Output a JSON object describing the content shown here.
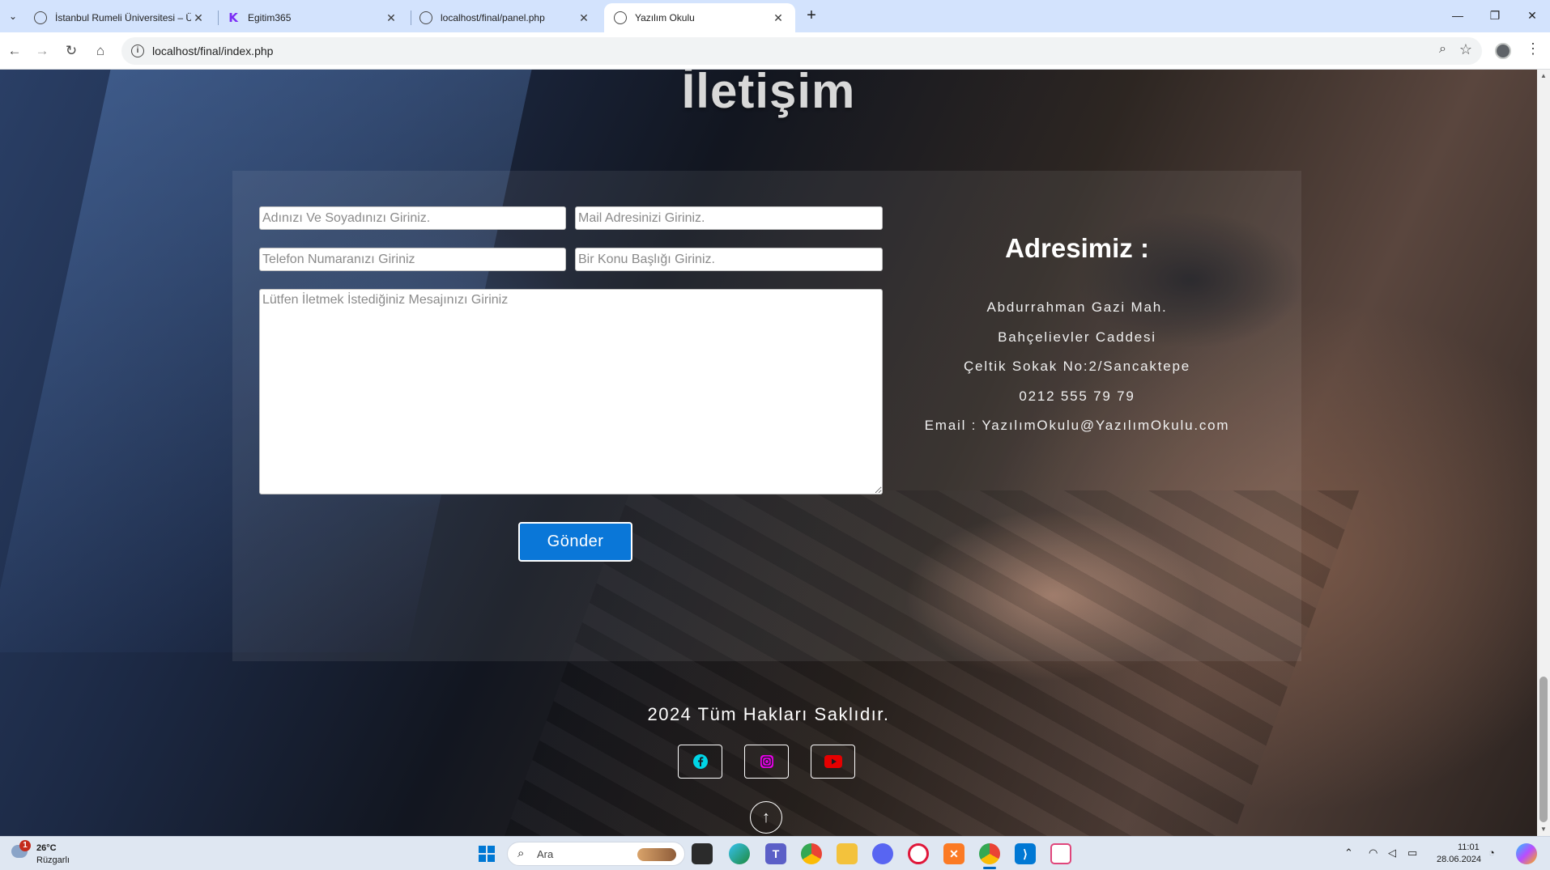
{
  "browser": {
    "tabs": [
      {
        "title": "İstanbul Rumeli Üniversitesi – Ü",
        "favicon": "globe-icon",
        "active": false
      },
      {
        "title": "Egitim365",
        "favicon": "k-logo-icon",
        "active": false
      },
      {
        "title": "localhost/final/panel.php",
        "favicon": "globe-icon",
        "active": false
      },
      {
        "title": "Yazılım Okulu",
        "favicon": "globe-icon",
        "active": true
      }
    ],
    "url": "localhost/final/index.php"
  },
  "page": {
    "title": "İletişim",
    "form": {
      "name_placeholder": "Adınızı Ve Soyadınızı Giriniz.",
      "email_placeholder": "Mail Adresinizi Giriniz.",
      "phone_placeholder": "Telefon Numaranızı Giriniz",
      "subject_placeholder": "Bir Konu Başlığı Giriniz.",
      "message_placeholder": "Lütfen İletmek İstediğiniz Mesajınızı Giriniz",
      "submit_label": "Gönder"
    },
    "address": {
      "title": "Adresimiz :",
      "lines": [
        "Abdurrahman Gazi Mah.",
        "Bahçelievler Caddesi",
        "Çeltik Sokak No:2/Sancaktepe",
        "0212 555 79 79",
        "Email : YazılımOkulu@YazılımOkulu.com"
      ]
    },
    "footer": {
      "copyright": "2024 Tüm Hakları Saklıdır.",
      "social": [
        {
          "name": "facebook-icon",
          "color": "#00d5e6"
        },
        {
          "name": "instagram-icon",
          "color": "#e600e6"
        },
        {
          "name": "youtube-icon",
          "color": "#e60000"
        }
      ],
      "back_to_top": "arrow-up-icon"
    }
  },
  "taskbar": {
    "weather_temp": "26°C",
    "weather_desc": "Rüzgarlı",
    "weather_badge": "1",
    "search_label": "Ara",
    "time": "11:01",
    "date": "28.06.2024"
  },
  "colors": {
    "accent": "#0a77d8",
    "tabstrip": "#d3e3fd"
  }
}
